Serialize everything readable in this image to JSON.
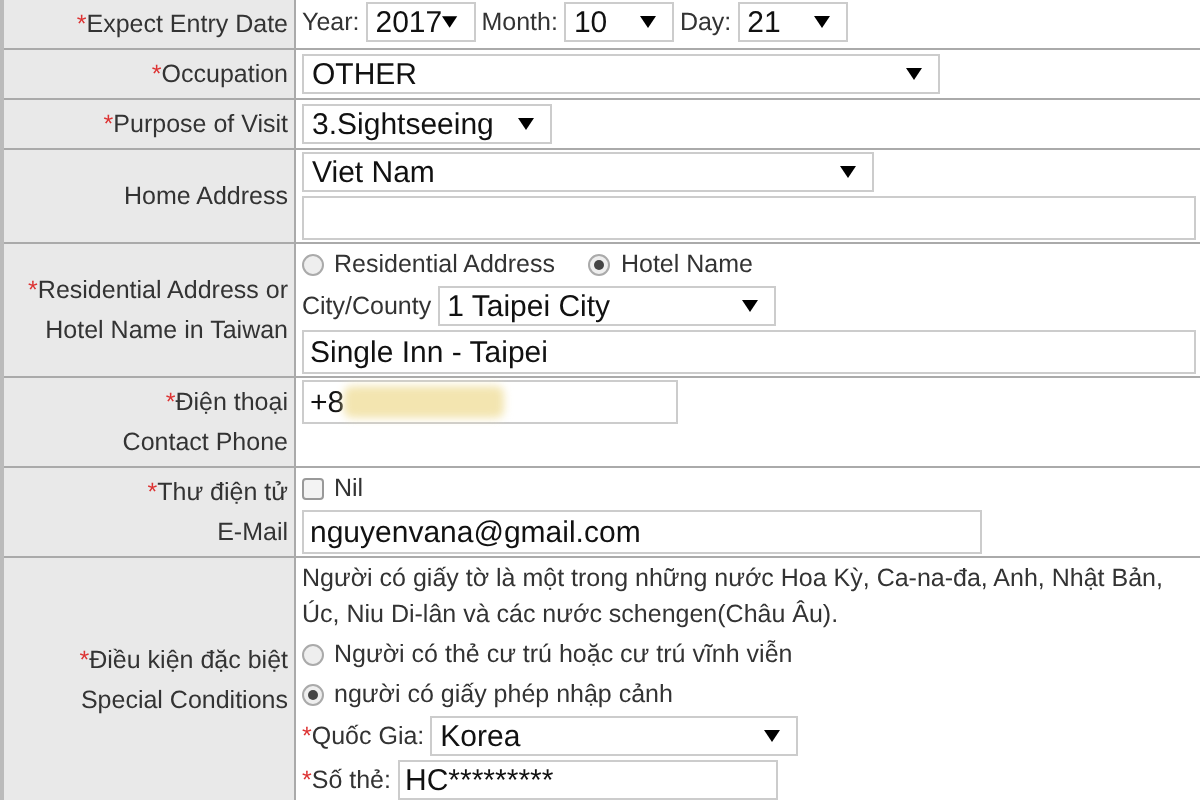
{
  "rows": [
    {
      "kind": "date",
      "mark": "*",
      "label": [
        "Expect Entry Date"
      ],
      "parts": [
        {
          "caption": "Year:",
          "value": "2017"
        },
        {
          "caption": "Month:",
          "value": "10"
        },
        {
          "caption": "Day:",
          "value": "21"
        }
      ]
    },
    {
      "kind": "select",
      "mark": "*",
      "label": [
        "Occupation"
      ],
      "value": "OTHER",
      "wide": true
    },
    {
      "kind": "select",
      "mark": "*",
      "label": [
        "Purpose of Visit"
      ],
      "value": "3.Sightseeing",
      "wide": false
    },
    {
      "kind": "address",
      "label": [
        "Home Address"
      ],
      "country": "Viet Nam"
    },
    {
      "kind": "residence",
      "mark": "*",
      "label": [
        "Residential Address or",
        "Hotel Name in Taiwan"
      ],
      "options": [
        {
          "label": "Residential Address",
          "selected": false
        },
        {
          "label": "Hotel Name",
          "selected": true
        }
      ],
      "city_caption": "City/County",
      "city": "1 Taipei City",
      "hotel": "Single Inn - Taipei"
    },
    {
      "kind": "phone",
      "mark": "*",
      "label": [
        "Điện thoại",
        "Contact Phone"
      ],
      "value": "+8"
    },
    {
      "kind": "email",
      "mark": "*",
      "label": [
        "Thư điện tử",
        "E-Mail"
      ],
      "nil": {
        "label": "Nil",
        "checked": false
      },
      "value": "nguyenvana@gmail.com"
    },
    {
      "kind": "special",
      "mark": "*",
      "label": [
        "Điều kiện đặc biệt",
        "Special Conditions"
      ],
      "note": "Người có giấy tờ là một trong những nước Hoa Kỳ, Ca-na-đa, Anh, Nhật Bản, Úc, Niu Di-lân và các nước schengen(Châu Âu).",
      "options": [
        {
          "label": "Người có thẻ cư trú hoặc cư trú vĩnh viễn",
          "selected": false
        },
        {
          "label": "người có giấy phép nhập cảnh",
          "selected": true
        }
      ],
      "fields": [
        {
          "mark": "*",
          "caption": "Quốc Gia:",
          "kind": "select",
          "value": "Korea"
        },
        {
          "mark": "*",
          "caption": "Số thẻ:",
          "kind": "input",
          "value": "HC*********"
        }
      ]
    }
  ]
}
